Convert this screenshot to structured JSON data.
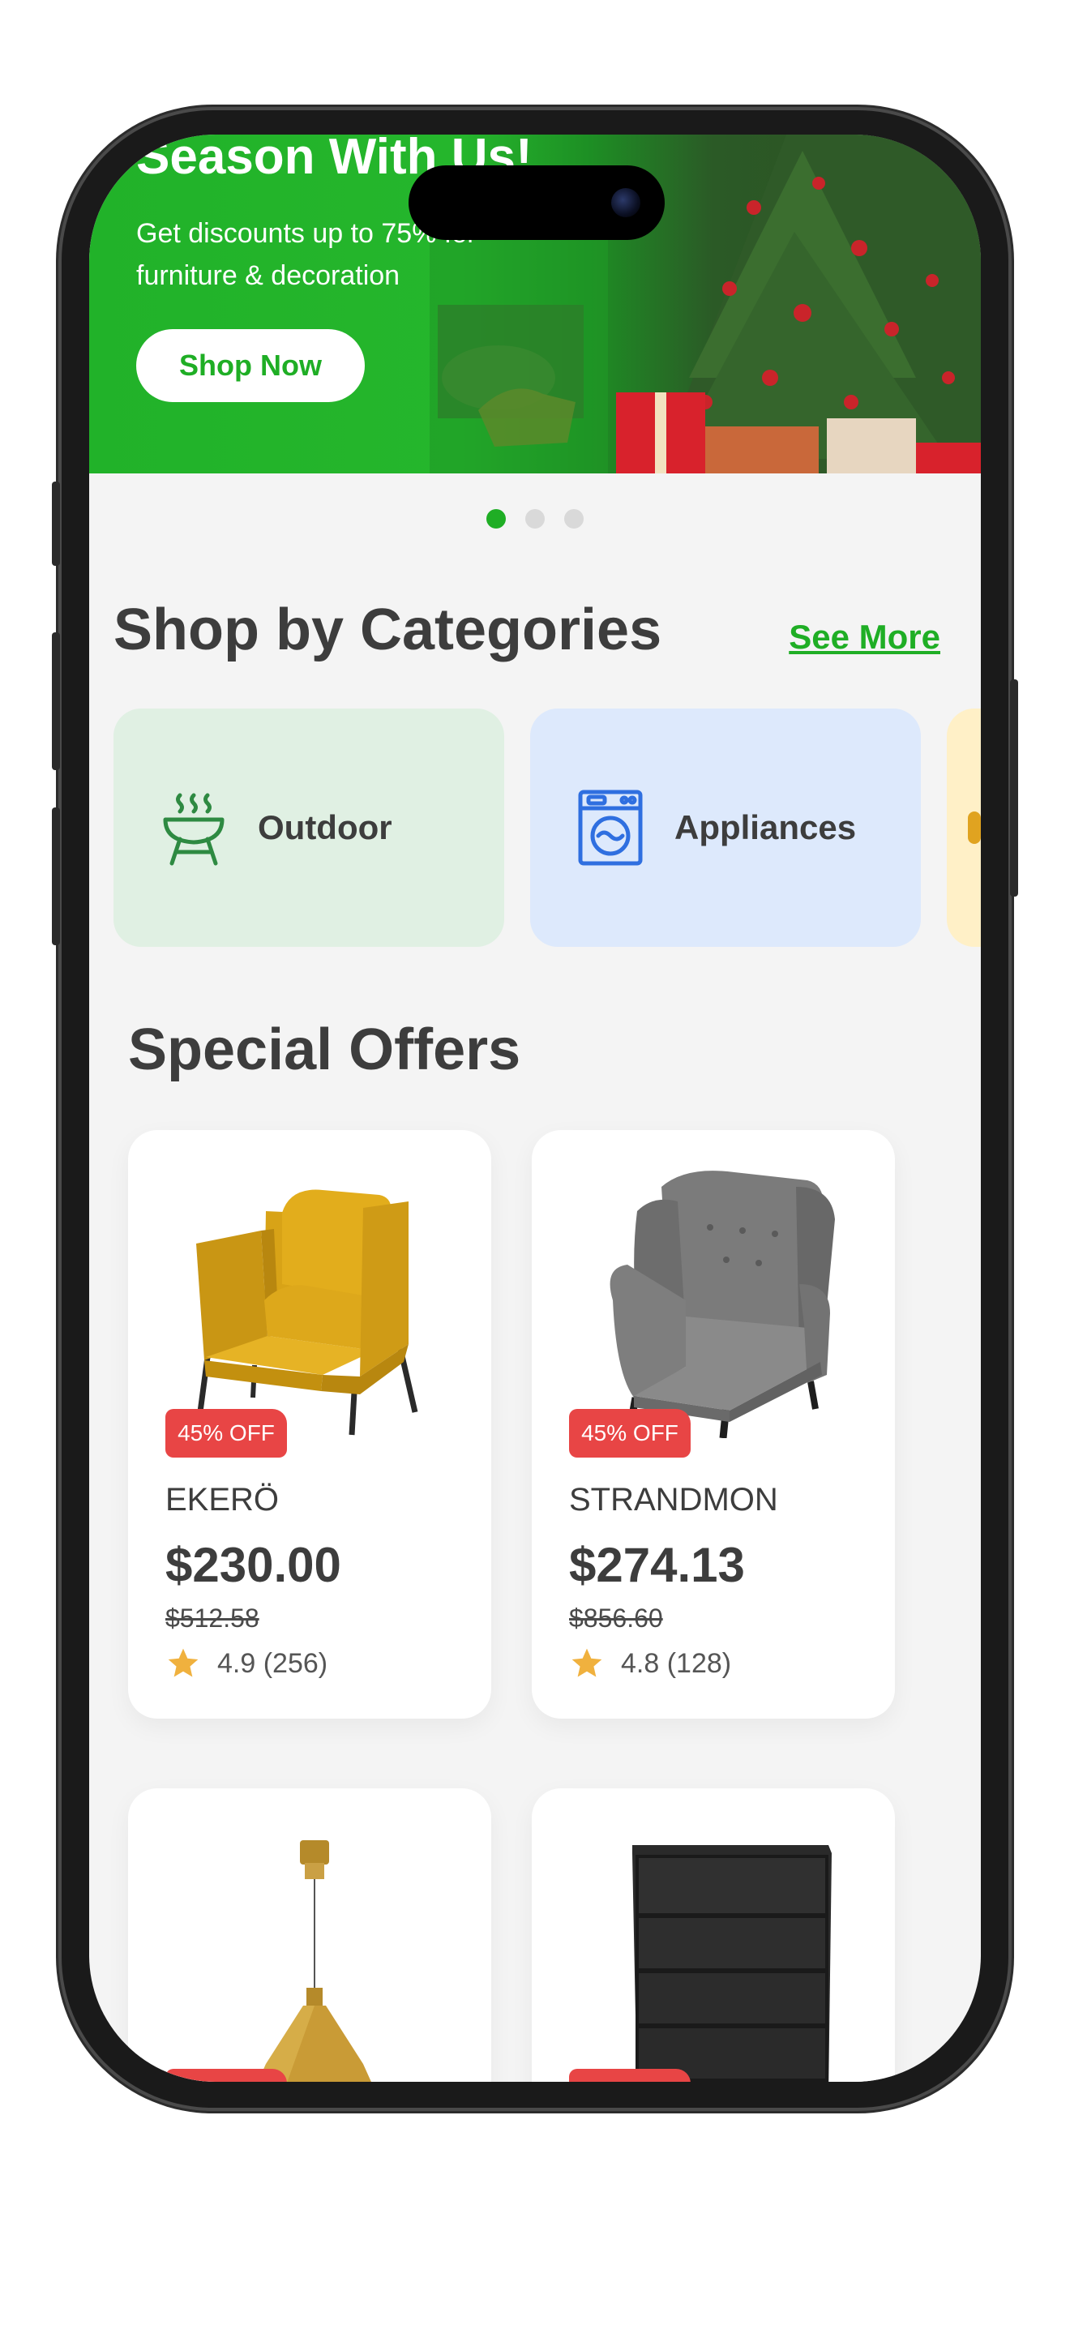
{
  "banner": {
    "title": "Season With Us!",
    "subtitle": "Get discounts up to 75% for furniture & decoration",
    "cta_label": "Shop Now"
  },
  "carousel": {
    "total": 3,
    "active": 0
  },
  "categories": {
    "title": "Shop by Categories",
    "see_more_label": "See More",
    "items": [
      {
        "label": "Outdoor",
        "icon": "grill-icon",
        "bg": "#e0f0e3"
      },
      {
        "label": "Appliances",
        "icon": "washing-machine-icon",
        "bg": "#dde9fc"
      },
      {
        "label": "",
        "icon": "",
        "bg": "#fff0c7"
      }
    ]
  },
  "offers": {
    "title": "Special Offers",
    "products": [
      {
        "name": "EKERÖ",
        "price": "$230.00",
        "old_price": "$512.58",
        "rating": "4.9 (256)",
        "badge": "45% OFF",
        "image": "yellow-armchair"
      },
      {
        "name": "STRANDMON",
        "price": "$274.13",
        "old_price": "$856.60",
        "rating": "4.8 (128)",
        "badge": "45% OFF",
        "image": "grey-wingback-chair"
      },
      {
        "name": "",
        "price": "",
        "old_price": "",
        "rating": "",
        "badge": "",
        "image": "brass-pendant-lamp"
      },
      {
        "name": "",
        "price": "",
        "old_price": "",
        "rating": "",
        "badge": "",
        "image": "black-dresser"
      }
    ]
  },
  "colors": {
    "accent": "#1fae25",
    "badge": "#e84545",
    "text": "#3d3d3d",
    "background": "#f4f4f4",
    "star": "#f0b13e"
  }
}
